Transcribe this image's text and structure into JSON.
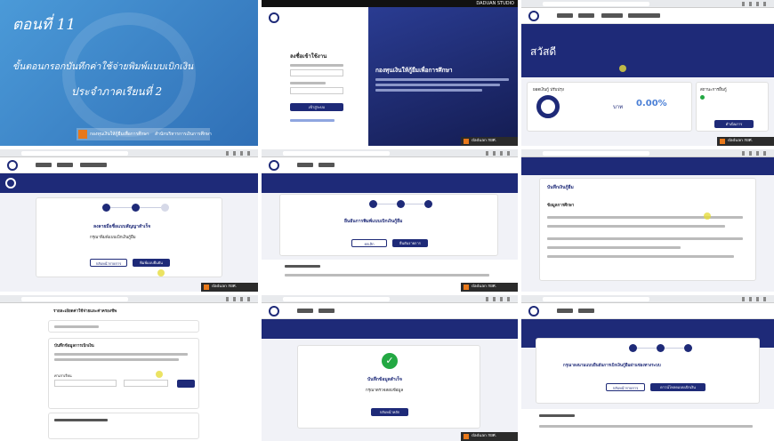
{
  "title_card": {
    "episode": "ตอนที่ 11",
    "heading_line1": "ขั้นตอนกรอกบันทึกค่าใช้จ่ายพิมพ์แบบเบิกเงิน",
    "heading_line2": "ประจำภาคเรียนที่ 2",
    "footer_left": "กองทุนเงินให้กู้ยืมเพื่อการศึกษา",
    "footer_right": "สำนักบริหารการเงินการศึกษา"
  },
  "login": {
    "form_title": "ลงชื่อเข้าใช้งาน",
    "submit": "เข้าสู่ระบบ",
    "hero": "กองทุนเงินให้กู้ยืมเพื่อการศึกษา",
    "studio": "DADUAN STUDIO"
  },
  "dashboard": {
    "greeting": "สวัสดี",
    "percent": "0.00%",
    "unit": "บาท",
    "card_left": "ยอดเงินกู้ ปรับปรุง",
    "card_right": "สถานะการยื่นกู้",
    "button": "ดำเนินการ"
  },
  "signed": {
    "heading": "ลงลายมือชื่อแบบสัญญาสำเร็จ",
    "sub": "กรุณาพิมพ์แบบเบิกเงินกู้ยืม",
    "btn_left": "กลับหน้ารายการ",
    "btn_right": "พิมพ์แบบยืนยัน"
  },
  "confirm": {
    "heading": "ยืนยันการพิมพ์แบบเบิกเงินกู้ยืม",
    "btn_left": "ยกเลิก",
    "btn_right": "ยืนยันรายการ"
  },
  "loan_info": {
    "heading": "บันทึกเงินกู้ยืม",
    "section": "ข้อมูลการศึกษา"
  },
  "form": {
    "heading": "รายละเอียดค่าใช้จ่ายและค่าครองชีพ",
    "sub": "บันทึกข้อมูลการเบิกเงิน",
    "field": "ค่าเล่าเรียน"
  },
  "success": {
    "heading": "บันทึกข้อมูลสำเร็จ",
    "sub": "กรุณาตรวจสอบข้อมูล",
    "btn": "กลับหน้าหลัก"
  },
  "print": {
    "heading": "กรุณาลงนามแบบยืนยันการเบิกเงินกู้ยืมผ่านช่องทางระบบ",
    "btn_left": "กลับหน้ารายการ",
    "btn_right": "ดาวน์โหลดแบบเบิกเงิน"
  },
  "watermark": "กยศ.",
  "colors": {
    "navy": "#1e2a78",
    "accent": "#4a7fd6",
    "success": "#23a843",
    "orange": "#e8781a"
  }
}
